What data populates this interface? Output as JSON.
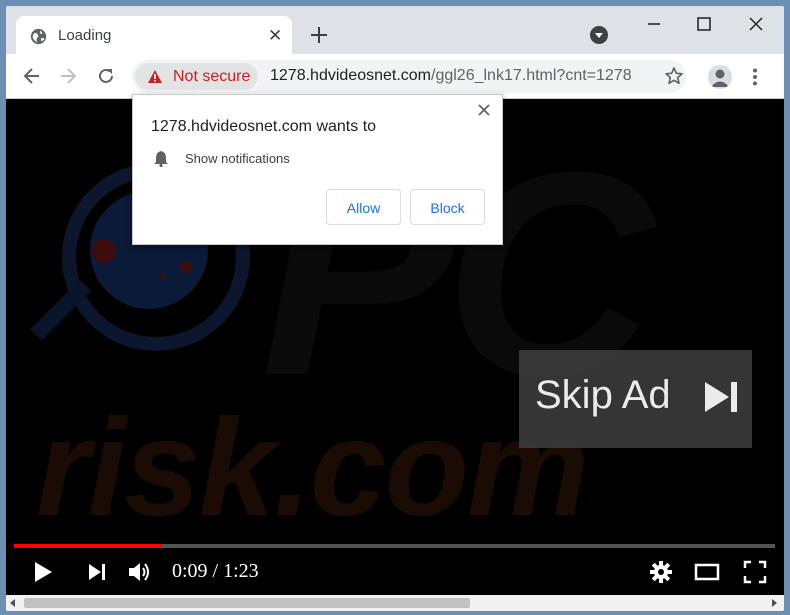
{
  "tab": {
    "title": "Loading",
    "close_glyph": "✕",
    "icon": "globe-icon"
  },
  "toolbar": {
    "security_label": "Not secure",
    "url_host": "1278.hdvideosnet.com",
    "url_path": "/ggl26_lnk17.html?cnt=1278"
  },
  "popup": {
    "origin_text": "1278.hdvideosnet.com wants to",
    "permission_text": "Show notifications",
    "allow_label": "Allow",
    "block_label": "Block"
  },
  "player": {
    "skip_label": "Skip Ad",
    "time_text": "0:09 / 1:23",
    "progress_fraction": 0.195
  },
  "watermark": {
    "line1": "PC",
    "line2": "risk.com"
  },
  "colors": {
    "warning": "#c5221f",
    "link_blue": "#1a73e8",
    "progress": "#ff0000"
  }
}
